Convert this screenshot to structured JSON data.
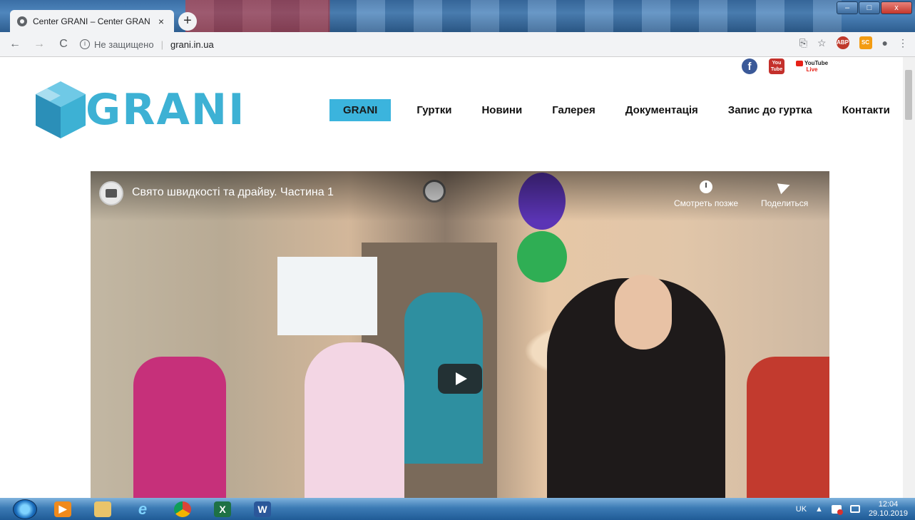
{
  "browser": {
    "tab_title": "Center GRANI – Center GRANI",
    "tab_close": "×",
    "new_tab": "+",
    "window_controls": [
      "–",
      "□",
      "x"
    ],
    "security_label": "Не защищено",
    "url": "grani.in.ua",
    "nav_back": "←",
    "nav_forward": "→",
    "nav_reload": "C",
    "star": "☆",
    "ext_abp": "ABP",
    "ext_sc": "SC",
    "menu": "⋮"
  },
  "social": {
    "facebook": "f",
    "youtube": "You Tube",
    "youtube_live_top": "YouTube",
    "youtube_live_bottom": "Live"
  },
  "logo": {
    "text": "GRANI",
    "colors": [
      "#3db1d4",
      "#2b8fb8",
      "#6fc9e6"
    ]
  },
  "nav": {
    "items": [
      "GRANI",
      "Гуртки",
      "Новини",
      "Галерея",
      "Документація",
      "Запис до гуртка",
      "Контакти"
    ],
    "active_index": 0,
    "accent_color": "#3bb4dd"
  },
  "video": {
    "title": "Свято швидкості та драйву. Частина 1",
    "watch_later": "Смотреть позже",
    "share": "Поделиться"
  },
  "taskbar": {
    "apps": [
      "media-player",
      "file-explorer",
      "internet-explorer",
      "chrome",
      "excel",
      "word"
    ],
    "app_labels": [
      "",
      "",
      "e",
      "",
      "X",
      "W"
    ],
    "language": "UK",
    "time": "12:04",
    "date": "29.10.2019"
  }
}
